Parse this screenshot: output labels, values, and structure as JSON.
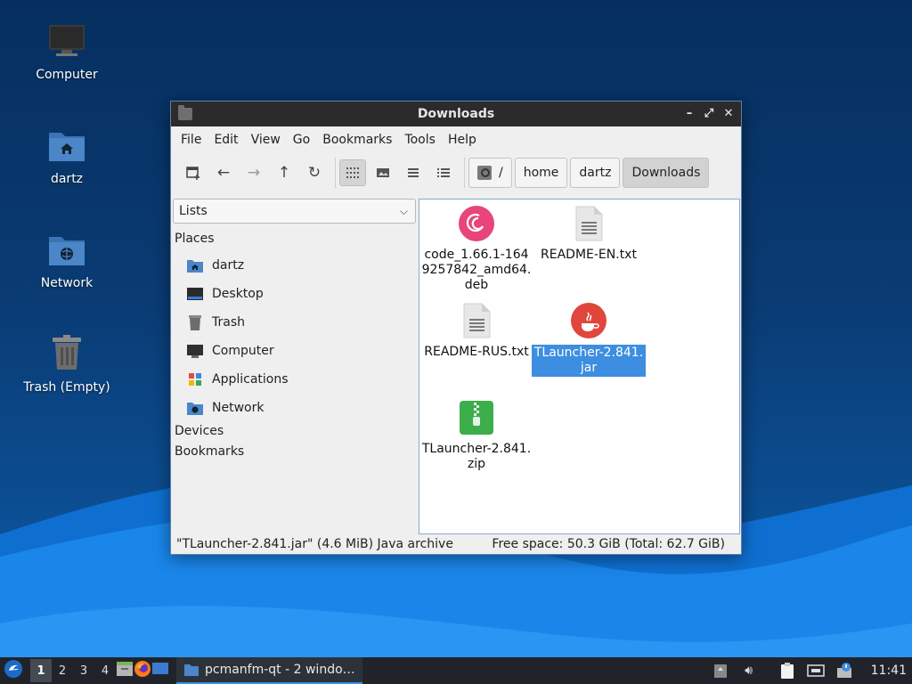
{
  "desktop": {
    "icons": [
      {
        "label": "Computer"
      },
      {
        "label": "dartz"
      },
      {
        "label": "Network"
      },
      {
        "label": "Trash (Empty)"
      }
    ]
  },
  "window": {
    "title": "Downloads",
    "menu": [
      "File",
      "Edit",
      "View",
      "Go",
      "Bookmarks",
      "Tools",
      "Help"
    ],
    "breadcrumb": [
      "/",
      "home",
      "dartz",
      "Downloads"
    ],
    "side": {
      "view_select": "Lists",
      "places_header": "Places",
      "places": [
        "dartz",
        "Desktop",
        "Trash",
        "Computer",
        "Applications",
        "Network"
      ],
      "devices_header": "Devices",
      "bookmarks_header": "Bookmarks"
    },
    "files": [
      {
        "name": "code_1.66.1-1649257842_amd64.deb",
        "line1": "code_1.66.1-164",
        "line2": "9257842_amd64.",
        "line3": "deb",
        "icon": "debian-package-icon"
      },
      {
        "name": "README-EN.txt",
        "icon": "text-file-icon"
      },
      {
        "name": "README-RUS.txt",
        "icon": "text-file-icon"
      },
      {
        "name": "TLauncher-2.841.jar",
        "line1": "TLauncher-2.841.",
        "line2": "jar",
        "icon": "java-icon",
        "selected": true
      },
      {
        "name": "TLauncher-2.841.zip",
        "line1": "TLauncher-2.841.",
        "line2": "zip",
        "icon": "zip-archive-icon"
      }
    ],
    "status_left": "\"TLauncher-2.841.jar\" (4.6 MiB) Java archive",
    "status_right": "Free space: 50.3 GiB (Total: 62.7 GiB)"
  },
  "taskbar": {
    "workspaces": [
      "1",
      "2",
      "3",
      "4"
    ],
    "active_workspace": "1",
    "task": "pcmanfm-qt - 2 windo…",
    "clock": "11:41"
  },
  "colors": {
    "selection": "#3d8ee0",
    "titlebar": "#2b2b2b",
    "taskbar": "#20242a",
    "folder": "#4a86c8"
  }
}
